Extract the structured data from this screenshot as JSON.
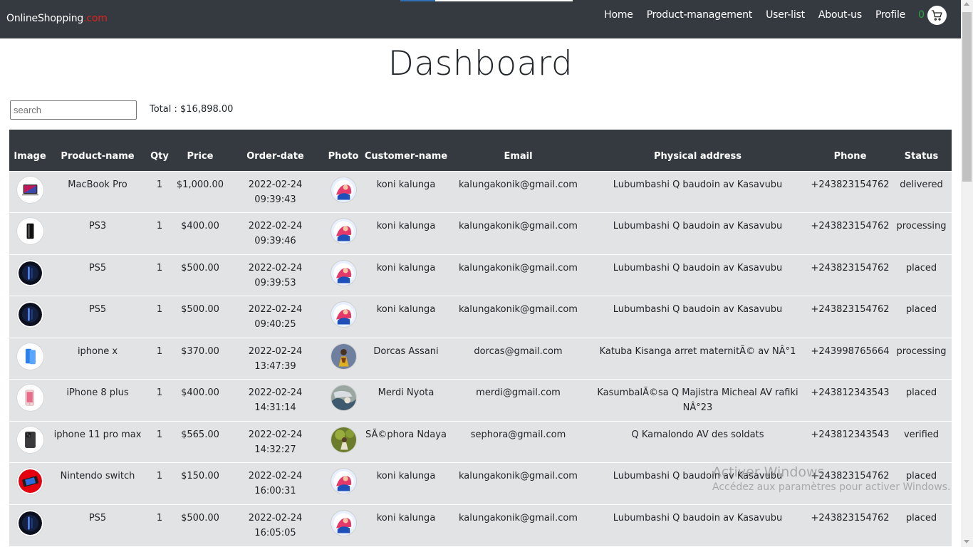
{
  "navbar": {
    "brand_main": "OnlineShopping",
    "brand_tld": ".com",
    "links": [
      "Home",
      "Product-management",
      "User-list",
      "About-us",
      "Profile"
    ],
    "cart_count": "0",
    "cart_icon": "cart-icon"
  },
  "page": {
    "title": "Dashboard",
    "search_placeholder": "search",
    "total_text": "Total : $16,898.00"
  },
  "table": {
    "headers": [
      "Image",
      "Product-name",
      "Qty",
      "Price",
      "Order-date",
      "Photo",
      "Customer-name",
      "Email",
      "Physical address",
      "Phone",
      "Status"
    ],
    "rows": [
      {
        "image": "macbook-thumb",
        "product": "MacBook Pro",
        "qty": "1",
        "price": "$1,000.00",
        "date": "2022-02-24",
        "time": "09:39:43",
        "photo": "koni-avatar",
        "customer": "koni kalunga",
        "email": "kalungakonik@gmail.com",
        "address": "Lubumbashi Q baudoin av Kasavubu",
        "phone": "+243823154762",
        "status": "delivered"
      },
      {
        "image": "ps3-thumb",
        "product": "PS3",
        "qty": "1",
        "price": "$400.00",
        "date": "2022-02-24",
        "time": "09:39:46",
        "photo": "koni-avatar",
        "customer": "koni kalunga",
        "email": "kalungakonik@gmail.com",
        "address": "Lubumbashi Q baudoin av Kasavubu",
        "phone": "+243823154762",
        "status": "processing"
      },
      {
        "image": "ps5-thumb",
        "product": "PS5",
        "qty": "1",
        "price": "$500.00",
        "date": "2022-02-24",
        "time": "09:39:53",
        "photo": "koni-avatar",
        "customer": "koni kalunga",
        "email": "kalungakonik@gmail.com",
        "address": "Lubumbashi Q baudoin av Kasavubu",
        "phone": "+243823154762",
        "status": "placed"
      },
      {
        "image": "ps5-thumb",
        "product": "PS5",
        "qty": "1",
        "price": "$500.00",
        "date": "2022-02-24",
        "time": "09:40:25",
        "photo": "koni-avatar",
        "customer": "koni kalunga",
        "email": "kalungakonik@gmail.com",
        "address": "Lubumbashi Q baudoin av Kasavubu",
        "phone": "+243823154762",
        "status": "placed"
      },
      {
        "image": "iphonex-thumb",
        "product": "iphone x",
        "qty": "1",
        "price": "$370.00",
        "date": "2022-02-24",
        "time": "13:47:39",
        "photo": "dorcas-avatar",
        "customer": "Dorcas Assani",
        "email": "dorcas@gmail.com",
        "address": "Katuba Kisanga arret maternitÃ© av NÂ°1",
        "phone": "+243998765664",
        "status": "processing"
      },
      {
        "image": "iphone8-thumb",
        "product": "iPhone 8 plus",
        "qty": "1",
        "price": "$400.00",
        "date": "2022-02-24",
        "time": "14:31:14",
        "photo": "merdi-avatar",
        "customer": "Merdi Nyota",
        "email": "merdi@gmail.com",
        "address": "KasumbalÃ©sa Q Majistra Micheal AV rafiki NÂ°23",
        "phone": "+243812343543",
        "status": "placed"
      },
      {
        "image": "iphone11-thumb",
        "product": "iphone 11 pro max",
        "qty": "1",
        "price": "$565.00",
        "date": "2022-02-24",
        "time": "14:32:27",
        "photo": "sephora-avatar",
        "customer": "SÃ©phora Ndaya",
        "email": "sephora@gmail.com",
        "address": "Q Kamalondo AV des soldats",
        "phone": "+243812343543",
        "status": "verified"
      },
      {
        "image": "switch-thumb",
        "product": "Nintendo switch",
        "qty": "1",
        "price": "$150.00",
        "date": "2022-02-24",
        "time": "16:00:31",
        "photo": "koni-avatar",
        "customer": "koni kalunga",
        "email": "kalungakonik@gmail.com",
        "address": "Lubumbashi Q baudoin av Kasavubu",
        "phone": "+243823154762",
        "status": "placed"
      },
      {
        "image": "ps5-thumb",
        "product": "PS5",
        "qty": "1",
        "price": "$500.00",
        "date": "2022-02-24",
        "time": "16:05:05",
        "photo": "koni-avatar",
        "customer": "koni kalunga",
        "email": "kalungakonik@gmail.com",
        "address": "Lubumbashi Q baudoin av Kasavubu",
        "phone": "+243823154762",
        "status": "placed"
      }
    ]
  },
  "watermark": {
    "line1": "Activer Windows",
    "line2": "Accédez aux paramètres pour activer Windows."
  }
}
